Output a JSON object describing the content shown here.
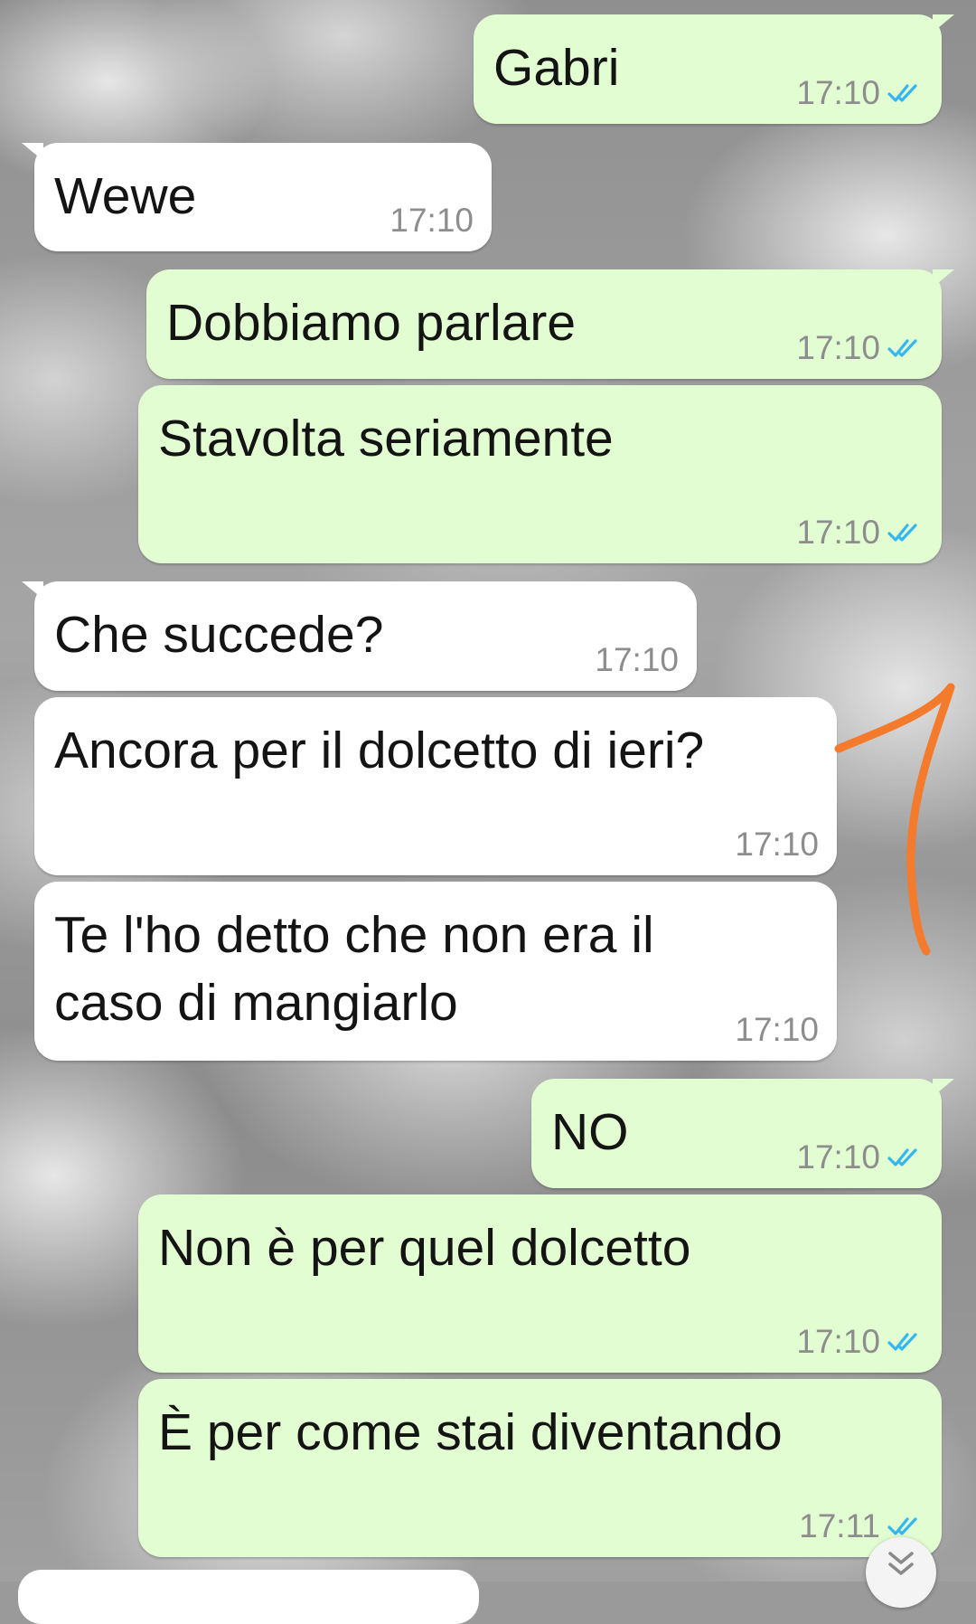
{
  "colors": {
    "outgoing_bubble": "#e2fdd2",
    "incoming_bubble": "#ffffff",
    "read_ticks": "#34b7f1",
    "annotation_stroke": "#f47a2c"
  },
  "messages": [
    {
      "text": "Gabri",
      "time": "17:10",
      "direction": "outgoing",
      "status": "read"
    },
    {
      "text": "Wewe",
      "time": "17:10",
      "direction": "incoming"
    },
    {
      "text": "Dobbiamo parlare",
      "time": "17:10",
      "direction": "outgoing",
      "status": "read"
    },
    {
      "text": "Stavolta seriamente",
      "time": "17:10",
      "direction": "outgoing",
      "status": "read"
    },
    {
      "text": "Che succede?",
      "time": "17:10",
      "direction": "incoming"
    },
    {
      "text": "Ancora per il dolcetto di ieri?",
      "time": "17:10",
      "direction": "incoming"
    },
    {
      "text": "Te l'ho detto che non era il\ncaso di mangiarlo",
      "time": "17:10",
      "direction": "incoming"
    },
    {
      "text": "NO",
      "time": "17:10",
      "direction": "outgoing",
      "status": "read"
    },
    {
      "text": "Non è per quel dolcetto",
      "time": "17:10",
      "direction": "outgoing",
      "status": "read"
    },
    {
      "text": "È per come stai diventando",
      "time": "17:11",
      "direction": "outgoing",
      "status": "read"
    }
  ],
  "icons": {
    "read_receipt": "double-check-icon",
    "scroll_down": "double-chevron-down-icon"
  }
}
